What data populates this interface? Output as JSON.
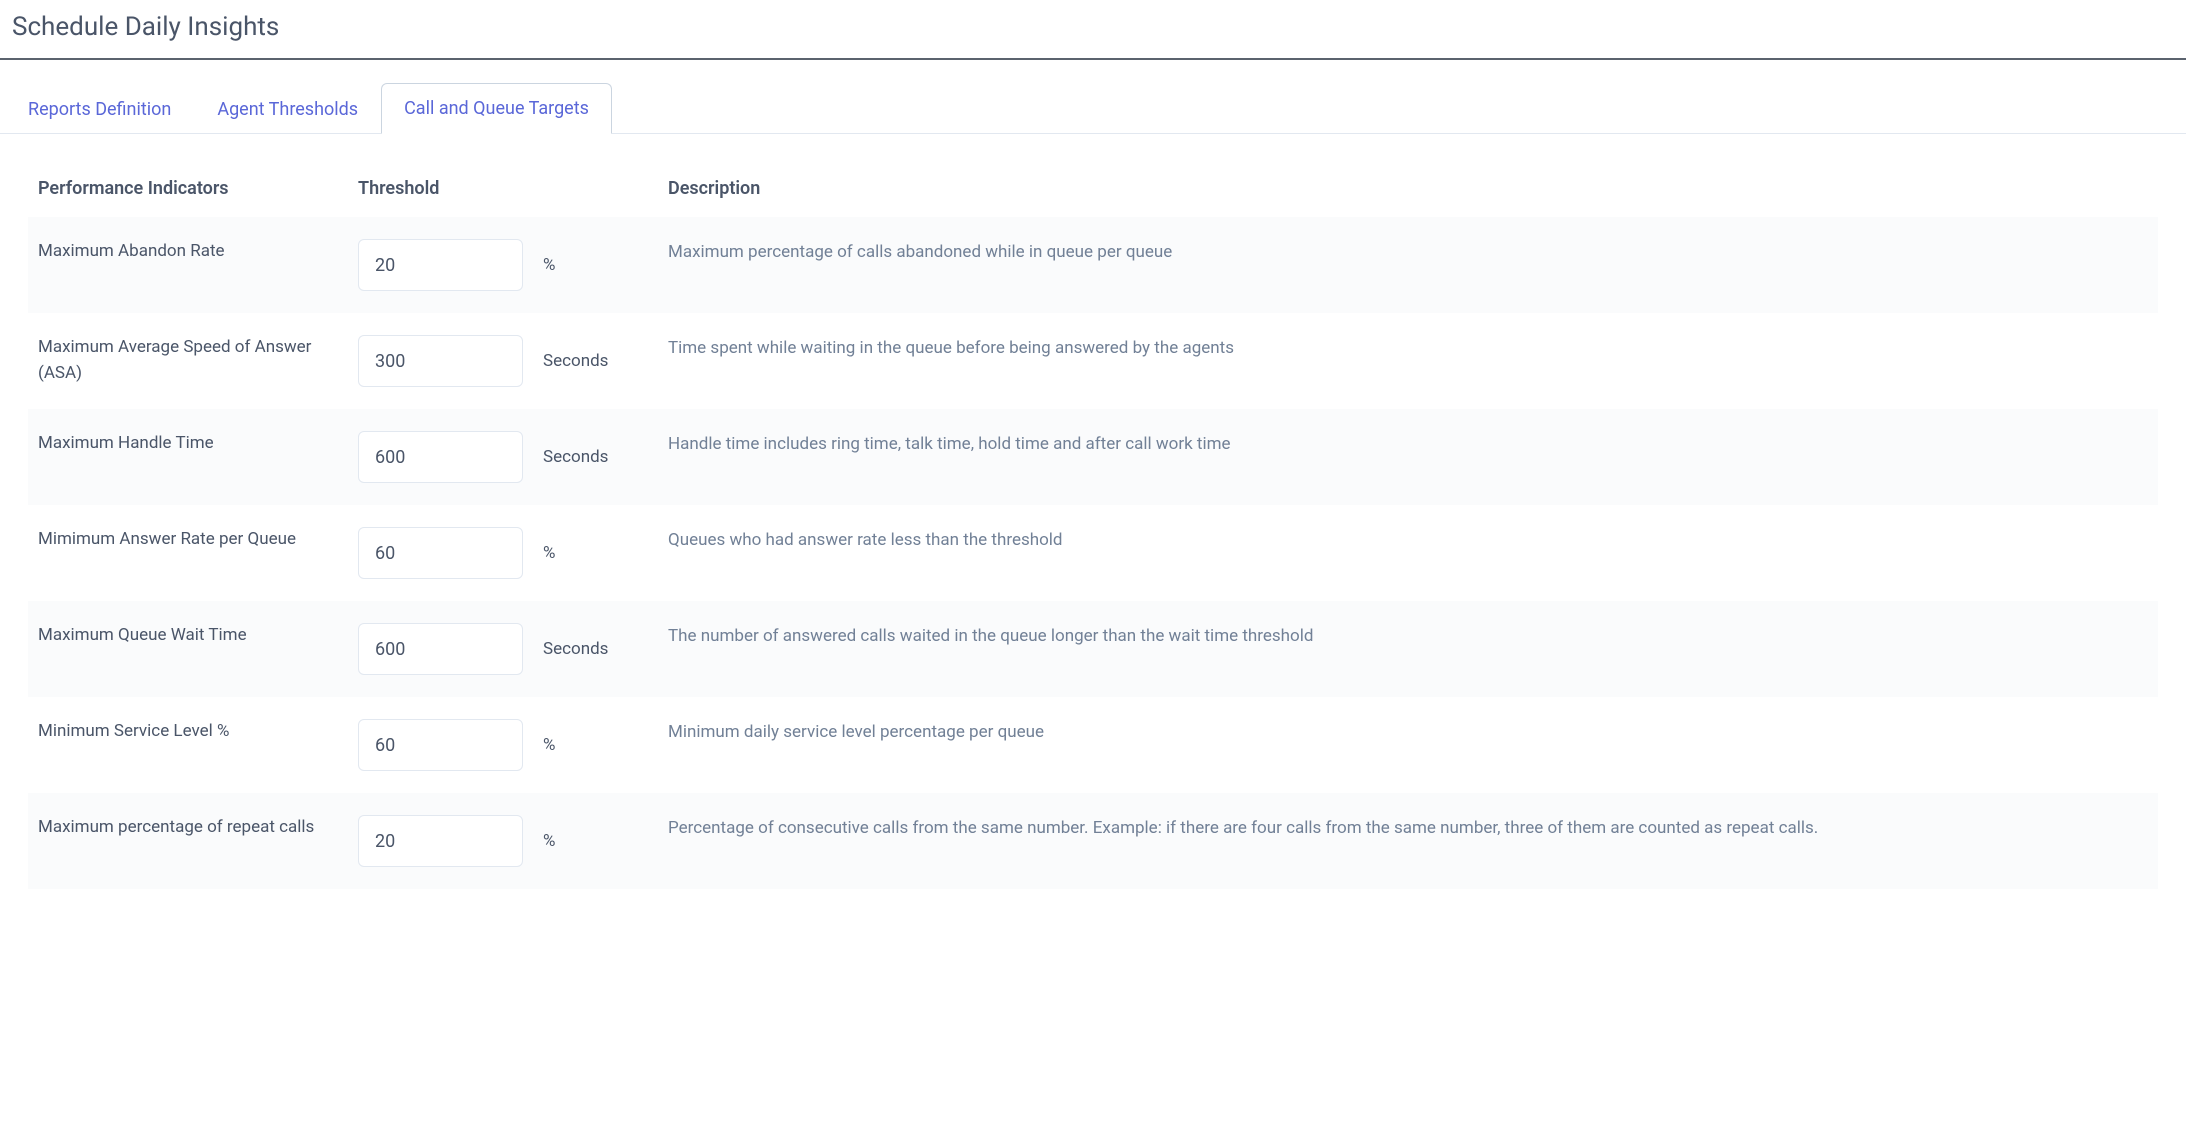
{
  "page": {
    "title": "Schedule Daily Insights"
  },
  "tabs": [
    {
      "label": "Reports Definition",
      "active": false
    },
    {
      "label": "Agent Thresholds",
      "active": false
    },
    {
      "label": "Call and Queue Targets",
      "active": true
    }
  ],
  "table": {
    "headers": {
      "indicator": "Performance Indicators",
      "threshold": "Threshold",
      "description": "Description"
    },
    "rows": [
      {
        "indicator": "Maximum Abandon Rate",
        "value": "20",
        "unit": "%",
        "description": "Maximum percentage of calls abandoned while in queue per queue"
      },
      {
        "indicator": "Maximum Average Speed of Answer (ASA)",
        "value": "300",
        "unit": "Seconds",
        "description": "Time spent while waiting in the queue before being answered by the agents"
      },
      {
        "indicator": "Maximum Handle Time",
        "value": "600",
        "unit": "Seconds",
        "description": "Handle time includes ring time, talk time, hold time and after call work time"
      },
      {
        "indicator": "Mimimum Answer Rate per Queue",
        "value": "60",
        "unit": "%",
        "description": "Queues who had answer rate less than the threshold"
      },
      {
        "indicator": "Maximum Queue Wait Time",
        "value": "600",
        "unit": "Seconds",
        "description": "The number of answered calls waited in the queue longer than the wait time threshold"
      },
      {
        "indicator": "Minimum Service Level %",
        "value": "60",
        "unit": "%",
        "description": "Minimum daily service level percentage per queue"
      },
      {
        "indicator": "Maximum percentage of repeat calls",
        "value": "20",
        "unit": "%",
        "description": "Percentage of consecutive calls from the same number. Example: if there are four calls from the same number, three of them are counted as repeat calls."
      }
    ]
  }
}
